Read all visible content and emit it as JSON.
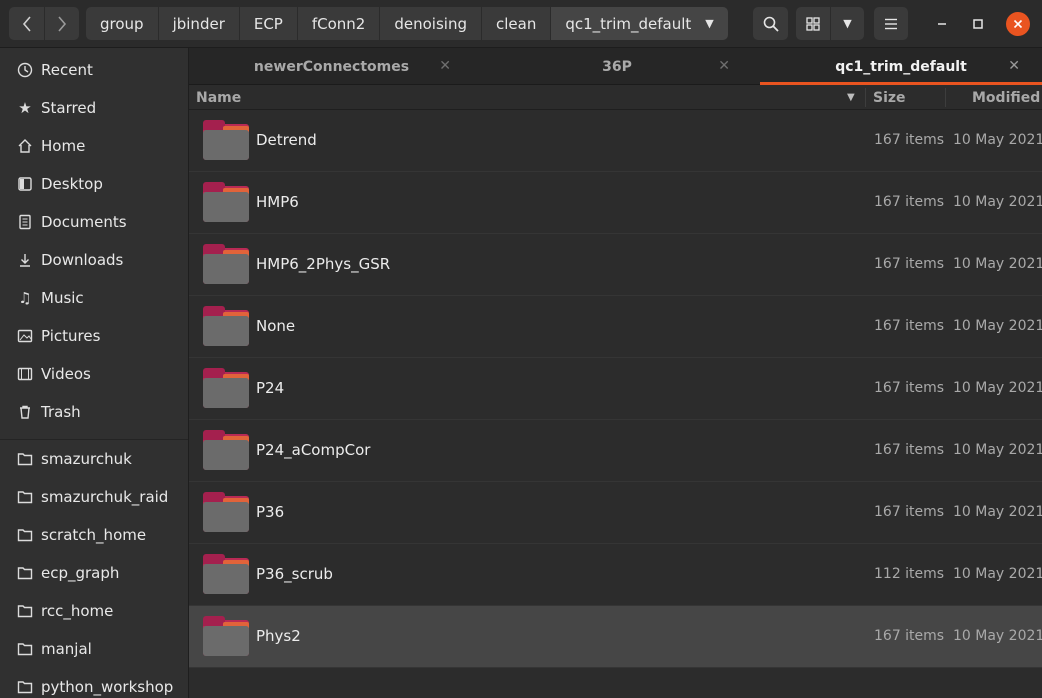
{
  "nav": {
    "back_icon": "chevron-left-icon",
    "forward_icon": "chevron-right-icon"
  },
  "path": {
    "crumbs": [
      "group",
      "jbinder",
      "ECP",
      "fConn2",
      "denoising",
      "clean",
      "qc1_trim_default"
    ]
  },
  "toolbar": {
    "search_icon": "search-icon",
    "view_icon": "grid-view-icon",
    "view_menu_icon": "chevron-down-icon",
    "menu_icon": "hamburger-menu-icon"
  },
  "window": {
    "minimize": "–",
    "maximize": "□",
    "close": "✕"
  },
  "sidebar": {
    "places": [
      {
        "label": "Recent",
        "icon": "clock-icon"
      },
      {
        "label": "Starred",
        "icon": "star-icon"
      },
      {
        "label": "Home",
        "icon": "home-icon"
      },
      {
        "label": "Desktop",
        "icon": "desktop-icon"
      },
      {
        "label": "Documents",
        "icon": "document-icon"
      },
      {
        "label": "Downloads",
        "icon": "download-icon"
      },
      {
        "label": "Music",
        "icon": "music-icon"
      },
      {
        "label": "Pictures",
        "icon": "pictures-icon"
      },
      {
        "label": "Videos",
        "icon": "video-icon"
      },
      {
        "label": "Trash",
        "icon": "trash-icon"
      }
    ],
    "bookmarks": [
      {
        "label": "smazurchuk",
        "icon": "folder-icon"
      },
      {
        "label": "smazurchuk_raid",
        "icon": "folder-icon"
      },
      {
        "label": "scratch_home",
        "icon": "folder-icon"
      },
      {
        "label": "ecp_graph",
        "icon": "folder-icon"
      },
      {
        "label": "rcc_home",
        "icon": "folder-icon"
      },
      {
        "label": "manjal",
        "icon": "folder-icon"
      },
      {
        "label": "python_workshop",
        "icon": "folder-icon"
      }
    ]
  },
  "tabs": [
    {
      "label": "newerConnectomes",
      "active": false
    },
    {
      "label": "36P",
      "active": false
    },
    {
      "label": "qc1_trim_default",
      "active": true
    }
  ],
  "columns": {
    "name": "Name",
    "size": "Size",
    "modified": "Modified"
  },
  "files": [
    {
      "name": "Detrend",
      "size": "167 items",
      "modified": "10 May 2021"
    },
    {
      "name": "HMP6",
      "size": "167 items",
      "modified": "10 May 2021"
    },
    {
      "name": "HMP6_2Phys_GSR",
      "size": "167 items",
      "modified": "10 May 2021"
    },
    {
      "name": "None",
      "size": "167 items",
      "modified": "10 May 2021"
    },
    {
      "name": "P24",
      "size": "167 items",
      "modified": "10 May 2021"
    },
    {
      "name": "P24_aCompCor",
      "size": "167 items",
      "modified": "10 May 2021"
    },
    {
      "name": "P36",
      "size": "167 items",
      "modified": "10 May 2021"
    },
    {
      "name": "P36_scrub",
      "size": "112 items",
      "modified": "10 May 2021"
    },
    {
      "name": "Phys2",
      "size": "167 items",
      "modified": "10 May 2021",
      "selected": true
    }
  ],
  "colors": {
    "accent": "#e95420",
    "folder_tab": "#b92a55",
    "folder_body": "#6b6b6b"
  }
}
